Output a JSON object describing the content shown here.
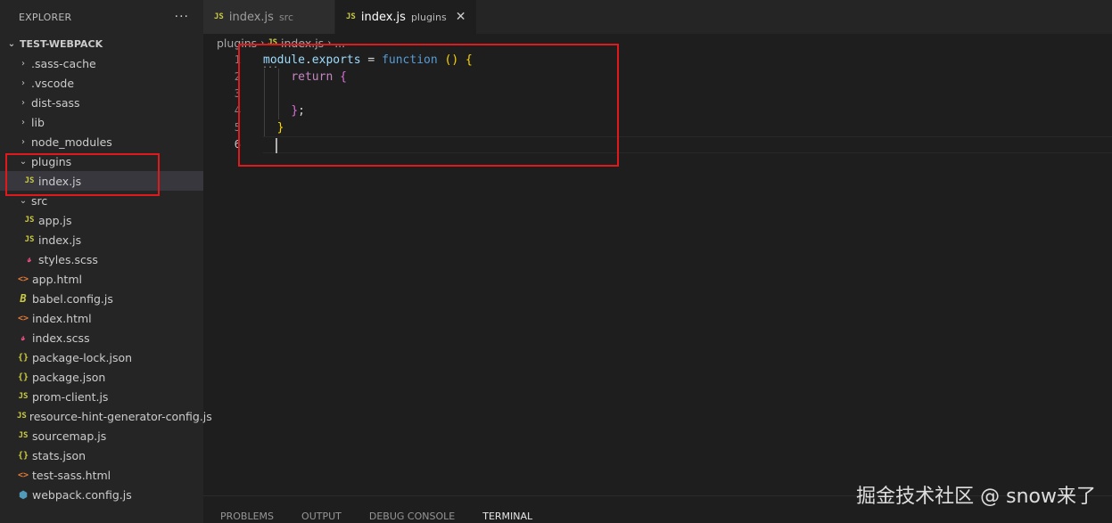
{
  "explorer": {
    "title": "EXPLORER",
    "more": "···",
    "project": "TEST-WEBPACK",
    "items": [
      {
        "label": ".sass-cache",
        "type": "folder"
      },
      {
        "label": ".vscode",
        "type": "folder"
      },
      {
        "label": "dist-sass",
        "type": "folder"
      },
      {
        "label": "lib",
        "type": "folder"
      },
      {
        "label": "node_modules",
        "type": "folder"
      },
      {
        "label": "plugins",
        "type": "folder-open"
      },
      {
        "label": "index.js",
        "type": "js"
      },
      {
        "label": "src",
        "type": "folder-open"
      },
      {
        "label": "app.js",
        "type": "js"
      },
      {
        "label": "index.js",
        "type": "js"
      },
      {
        "label": "styles.scss",
        "type": "scss"
      },
      {
        "label": "app.html",
        "type": "html"
      },
      {
        "label": "babel.config.js",
        "type": "babel"
      },
      {
        "label": "index.html",
        "type": "html"
      },
      {
        "label": "index.scss",
        "type": "scss"
      },
      {
        "label": "package-lock.json",
        "type": "json"
      },
      {
        "label": "package.json",
        "type": "json"
      },
      {
        "label": "prom-client.js",
        "type": "js"
      },
      {
        "label": "resource-hint-generator-config.js",
        "type": "js"
      },
      {
        "label": "sourcemap.js",
        "type": "js"
      },
      {
        "label": "stats.json",
        "type": "json"
      },
      {
        "label": "test-sass.html",
        "type": "html"
      },
      {
        "label": "webpack.config.js",
        "type": "webpack"
      }
    ]
  },
  "icons": {
    "js": "JS",
    "html": "<>",
    "json": "{}",
    "chevron_right": "›",
    "chevron_down": "⌄",
    "close": "✕"
  },
  "tabs": [
    {
      "label": "index.js",
      "desc": "src",
      "active": false
    },
    {
      "label": "index.js",
      "desc": "plugins",
      "active": true
    }
  ],
  "breadcrumb": {
    "folder": "plugins",
    "file": "index.js",
    "more": "..."
  },
  "editor": {
    "line_numbers": [
      "1",
      "2",
      "3",
      "4",
      "5",
      "6"
    ],
    "code": {
      "l1_obj": "module",
      "l1_dot": ".",
      "l1_prop": "exports",
      "l1_eq": " = ",
      "l1_fn": "function",
      "l1_paren": " ()",
      "l1_brace": " {",
      "l2_ret": "return",
      "l2_brace": " {",
      "l4_close": "}",
      "l4_semi": ";",
      "l5_close": "}",
      "fold_hint": "..."
    }
  },
  "panel": {
    "tabs": [
      "PROBLEMS",
      "OUTPUT",
      "DEBUG CONSOLE",
      "TERMINAL"
    ]
  },
  "watermark": "掘金技术社区 @ snow来了",
  "colors": {
    "highlight_box": "#e0191c",
    "js_icon": "#cbcb41",
    "keyword": "#569cd6",
    "control": "#c586c0"
  }
}
